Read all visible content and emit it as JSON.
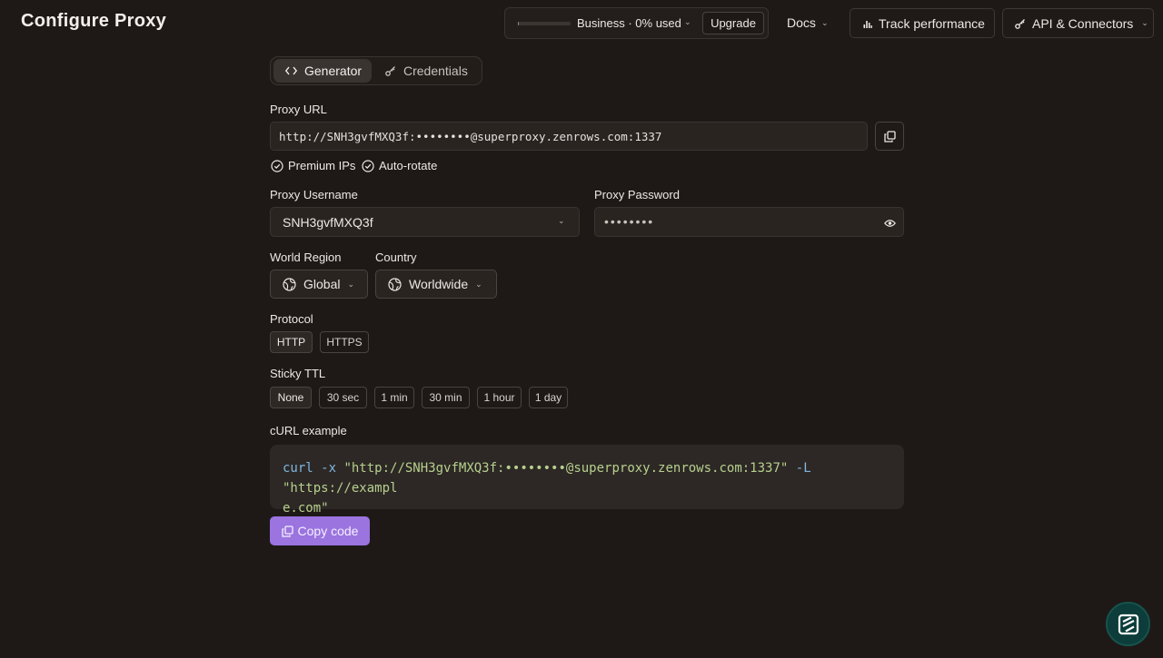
{
  "header": {
    "title": "Configure Proxy",
    "plan": {
      "label": "Business · 0% used",
      "usage_percent": 0,
      "upgrade_label": "Upgrade"
    },
    "docs_label": "Docs",
    "track_label": "Track performance",
    "api_label": "API & Connectors"
  },
  "tabs": [
    {
      "label": "Generator",
      "active": true,
      "icon": "code-icon"
    },
    {
      "label": "Credentials",
      "active": false,
      "icon": "key-icon"
    }
  ],
  "proxy_url": {
    "label": "Proxy URL",
    "value": "http://SNH3gvfMXQ3f:••••••••@superproxy.zenrows.com:1337"
  },
  "options": [
    {
      "label": "Premium IPs",
      "checked": true
    },
    {
      "label": "Auto-rotate",
      "checked": true
    }
  ],
  "username": {
    "label": "Proxy Username",
    "value": "SNH3gvfMXQ3f"
  },
  "password": {
    "label": "Proxy Password",
    "value": "••••••••"
  },
  "region": {
    "label": "World Region",
    "value": "Global"
  },
  "country": {
    "label": "Country",
    "value": "Worldwide"
  },
  "protocol": {
    "label": "Protocol",
    "options": [
      "HTTP",
      "HTTPS"
    ],
    "selected": "HTTP"
  },
  "sticky_ttl": {
    "label": "Sticky TTL",
    "options": [
      "None",
      "30 sec",
      "1 min",
      "30 min",
      "1 hour",
      "1 day"
    ],
    "selected": "None"
  },
  "curl": {
    "label": "cURL example",
    "cmd": "curl",
    "flag_x": "-x",
    "proxy_str": "\"http://SNH3gvfMXQ3f:••••••••@superproxy.zenrows.com:1337\"",
    "flag_l": "-L",
    "target_str_1": "\"https://exampl",
    "target_str_2": "e.com\"",
    "copy_label": "Copy code"
  },
  "colors": {
    "background": "#1e1917",
    "accent": "#9b74e0",
    "code_command": "#7fb6e0",
    "code_string": "#b6d08e",
    "chat_bubble": "#0c3d3a"
  }
}
